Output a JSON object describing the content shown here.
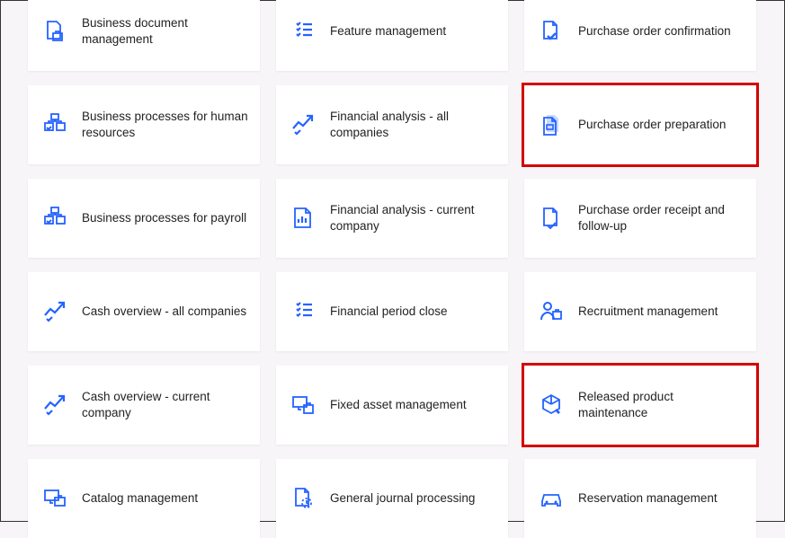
{
  "tiles": {
    "r0c0": {
      "label": "Business document management"
    },
    "r0c1": {
      "label": "Feature management"
    },
    "r0c2": {
      "label": "Purchase order confirmation"
    },
    "r1c0": {
      "label": "Business processes for human resources"
    },
    "r1c1": {
      "label": "Financial analysis - all companies"
    },
    "r1c2": {
      "label": "Purchase order preparation"
    },
    "r2c0": {
      "label": "Business processes for payroll"
    },
    "r2c1": {
      "label": "Financial analysis - current company"
    },
    "r2c2": {
      "label": "Purchase order receipt and follow-up"
    },
    "r3c0": {
      "label": "Cash overview - all companies"
    },
    "r3c1": {
      "label": "Financial period close"
    },
    "r3c2": {
      "label": "Recruitment management"
    },
    "r4c0": {
      "label": "Cash overview - current company"
    },
    "r4c1": {
      "label": "Fixed asset management"
    },
    "r4c2": {
      "label": "Released product maintenance"
    },
    "r5c0": {
      "label": "Catalog management"
    },
    "r5c1": {
      "label": "General journal processing"
    },
    "r5c2": {
      "label": "Reservation management"
    }
  }
}
